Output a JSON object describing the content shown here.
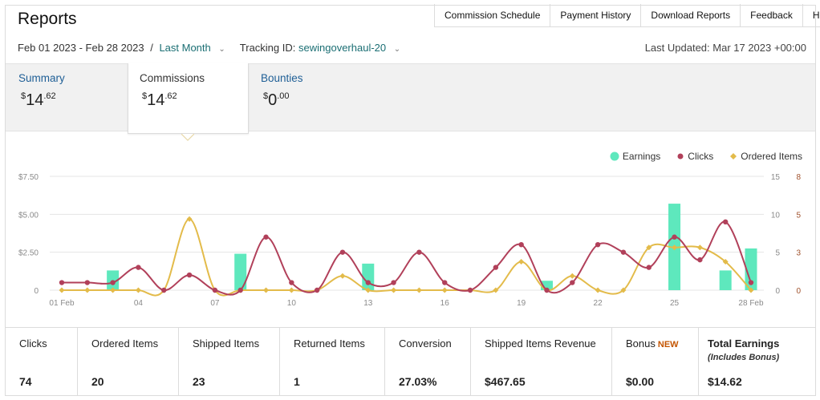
{
  "header": {
    "title": "Reports",
    "menu": [
      "Commission Schedule",
      "Payment History",
      "Download Reports",
      "Feedback",
      "Help"
    ]
  },
  "filters": {
    "date_range": "Feb 01 2023 - Feb 28 2023",
    "separator": "/",
    "period": "Last Month",
    "tracking_label": "Tracking ID:",
    "tracking_id": "sewingoverhaul-20",
    "last_updated": "Last Updated: Mar 17 2023 +00:00"
  },
  "tabs": [
    {
      "label": "Summary",
      "currency": "$",
      "whole": "14",
      "cents": ".62",
      "active": false
    },
    {
      "label": "Commissions",
      "currency": "$",
      "whole": "14",
      "cents": ".62",
      "active": true
    },
    {
      "label": "Bounties",
      "currency": "$",
      "whole": "0",
      "cents": ".00",
      "active": false
    }
  ],
  "icons": {
    "dropdown": "chevron-down-icon",
    "legend_earnings": "circle-marker-icon",
    "legend_clicks": "circle-marker-icon",
    "legend_ordered": "diamond-marker-icon"
  },
  "colors": {
    "earnings": "#5ee8bd",
    "clicks": "#b1405a",
    "ordered": "#e3bb4a",
    "grid": "#e4e4e4",
    "axis_text": "#8a8a8a",
    "right_axis_text": "#a0522d",
    "link": "#1a6e73"
  },
  "chart_data": {
    "type": "bar",
    "legend": [
      "Earnings",
      "Clicks",
      "Ordered Items"
    ],
    "legend_position": "top-right",
    "x_tick_labels": [
      "01 Feb",
      "04",
      "07",
      "10",
      "13",
      "16",
      "19",
      "22",
      "25",
      "28 Feb"
    ],
    "x": [
      1,
      2,
      3,
      4,
      5,
      6,
      7,
      8,
      9,
      10,
      11,
      12,
      13,
      14,
      15,
      16,
      17,
      18,
      19,
      20,
      21,
      22,
      23,
      24,
      25,
      26,
      27,
      28
    ],
    "y_left": {
      "ticks": [
        "0",
        "$2.50",
        "$5.00",
        "$7.50"
      ],
      "range": [
        0,
        7.5
      ]
    },
    "y_right_clicks": {
      "ticks": [
        "0",
        "5",
        "10",
        "15"
      ],
      "range": [
        0,
        15
      ]
    },
    "y_right_ordered": {
      "ticks": [
        "0",
        "3",
        "5",
        "8"
      ],
      "range": [
        0,
        8
      ]
    },
    "grid": true,
    "series": [
      {
        "name": "Earnings",
        "type": "bar",
        "axis": "left",
        "values": [
          0,
          0,
          1.3,
          0,
          0,
          0,
          0,
          2.4,
          0,
          0,
          0,
          0,
          1.75,
          0,
          0,
          0,
          0,
          0,
          0,
          0.62,
          0,
          0,
          0,
          0,
          5.7,
          0,
          1.3,
          2.75
        ]
      },
      {
        "name": "Clicks",
        "type": "line",
        "axis": "right_clicks",
        "values": [
          1,
          1,
          1,
          3,
          0,
          2,
          0,
          0,
          7,
          1,
          0,
          5,
          1,
          1,
          5,
          1,
          0,
          3,
          6,
          0,
          1,
          6,
          5,
          3,
          7,
          4,
          9,
          1
        ]
      },
      {
        "name": "Ordered Items",
        "type": "line",
        "axis": "right_ordered",
        "values": [
          0,
          0,
          0,
          0,
          0,
          5,
          0,
          0,
          0,
          0,
          0,
          1,
          0,
          0,
          0,
          0,
          0,
          0,
          2,
          0,
          1,
          0,
          0,
          3,
          3,
          3,
          2,
          0
        ]
      }
    ]
  },
  "stats": [
    {
      "label": "Clicks",
      "value": "74"
    },
    {
      "label": "Ordered Items",
      "value": "20"
    },
    {
      "label": "Shipped Items",
      "value": "23"
    },
    {
      "label": "Returned Items",
      "value": "1"
    },
    {
      "label": "Conversion",
      "value": "27.03%"
    },
    {
      "label": "Shipped Items Revenue",
      "value": "$467.65"
    },
    {
      "label": "Bonus",
      "badge": "NEW",
      "value": "$0.00"
    },
    {
      "label": "Total Earnings",
      "sublabel": "(Includes Bonus)",
      "value": "$14.62"
    }
  ]
}
